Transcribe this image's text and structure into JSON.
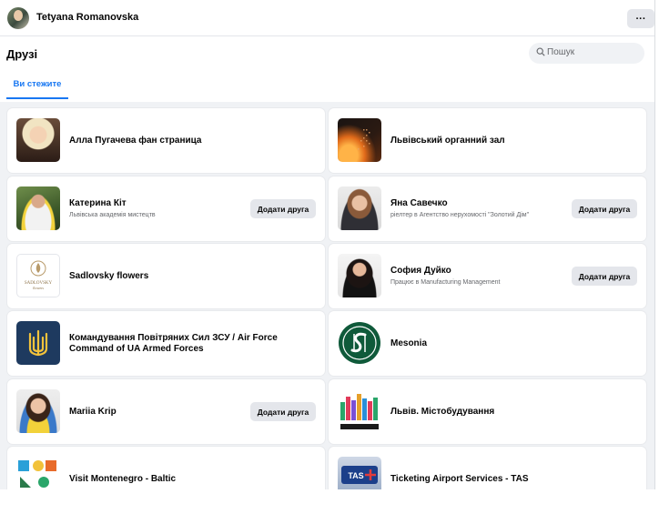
{
  "header": {
    "user_name": "Tetyana Romanovska",
    "more_label": "···"
  },
  "page": {
    "title": "Друзі",
    "search_placeholder": "Пошук",
    "tab_label": "Ви стежите"
  },
  "friends": [
    {
      "name": "Алла Пугачева фан страница",
      "subtitle": "",
      "button": ""
    },
    {
      "name": "Львівський органний зал",
      "subtitle": "",
      "button": ""
    },
    {
      "name": "Катерина Кіт",
      "subtitle": "Львівська академія мистецтв",
      "button": "Додати друга"
    },
    {
      "name": "Яна Савечко",
      "subtitle": "ріелтер в Агентство нерухомості \"Золотий Дім\"",
      "button": "Додати друга"
    },
    {
      "name": "Sadlovsky flowers",
      "subtitle": "",
      "button": "",
      "logo_text": "SADLOVSKY",
      "logo_sub": "flowers"
    },
    {
      "name": "София Дуйко",
      "subtitle": "Працює в Manufacturing Management",
      "button": "Додати друга"
    },
    {
      "name": "Командування Повітряних Сил ЗСУ / Air Force Command of UA Armed Forces",
      "subtitle": "",
      "button": ""
    },
    {
      "name": "Mesonia",
      "subtitle": "",
      "button": ""
    },
    {
      "name": "Mariia Krip",
      "subtitle": "",
      "button": "Додати друга"
    },
    {
      "name": "Львів. Містобудування",
      "subtitle": "",
      "button": ""
    },
    {
      "name": "Visit Montenegro - Baltic",
      "subtitle": "",
      "button": ""
    },
    {
      "name": "Ticketing Airport Services - TAS",
      "subtitle": "",
      "button": ""
    }
  ],
  "colors": {
    "accent": "#1877f2",
    "background": "#f0f2f5",
    "button_bg": "#e4e6eb",
    "secondary_text": "#65676b"
  }
}
